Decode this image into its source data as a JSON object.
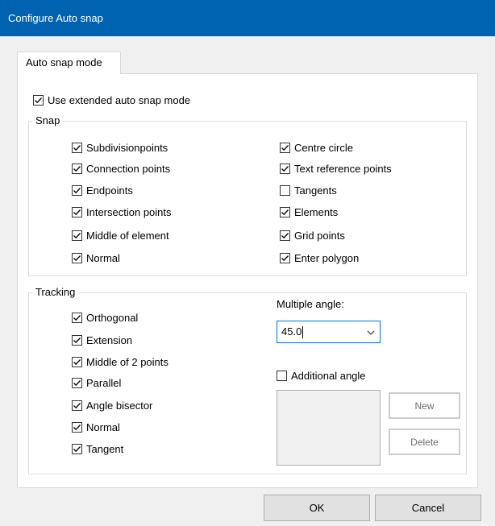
{
  "window": {
    "title": "Configure Auto snap"
  },
  "tab": {
    "label": "Auto snap mode"
  },
  "extended": {
    "label": "Use extended auto snap mode",
    "checked": true
  },
  "snap": {
    "title": "Snap",
    "left": [
      {
        "label": "Subdivisionpoints",
        "checked": true
      },
      {
        "label": "Connection points",
        "checked": true
      },
      {
        "label": "Endpoints",
        "checked": true
      },
      {
        "label": "Intersection points",
        "checked": true
      },
      {
        "label": "Middle of element",
        "checked": true
      },
      {
        "label": "Normal",
        "checked": true
      }
    ],
    "right": [
      {
        "label": "Centre circle",
        "checked": true
      },
      {
        "label": "Text reference points",
        "checked": true
      },
      {
        "label": "Tangents",
        "checked": false
      },
      {
        "label": "Elements",
        "checked": true
      },
      {
        "label": "Grid points",
        "checked": true
      },
      {
        "label": "Enter polygon",
        "checked": true
      }
    ]
  },
  "tracking": {
    "title": "Tracking",
    "items": [
      {
        "label": "Orthogonal",
        "checked": true
      },
      {
        "label": "Extension",
        "checked": true
      },
      {
        "label": "Middle of 2 points",
        "checked": true
      },
      {
        "label": "Parallel",
        "checked": true
      },
      {
        "label": "Angle bisector",
        "checked": true
      },
      {
        "label": "Normal",
        "checked": true
      },
      {
        "label": "Tangent",
        "checked": true
      }
    ],
    "multiple_angle_label": "Multiple angle:",
    "multiple_angle_value": "45.0",
    "additional_angle": {
      "label": "Additional angle",
      "checked": false
    },
    "new_label": "New",
    "delete_label": "Delete"
  },
  "footer": {
    "ok_label": "OK",
    "cancel_label": "Cancel"
  },
  "colors": {
    "titlebar": "#0063b1",
    "focus_border": "#0078d7"
  }
}
